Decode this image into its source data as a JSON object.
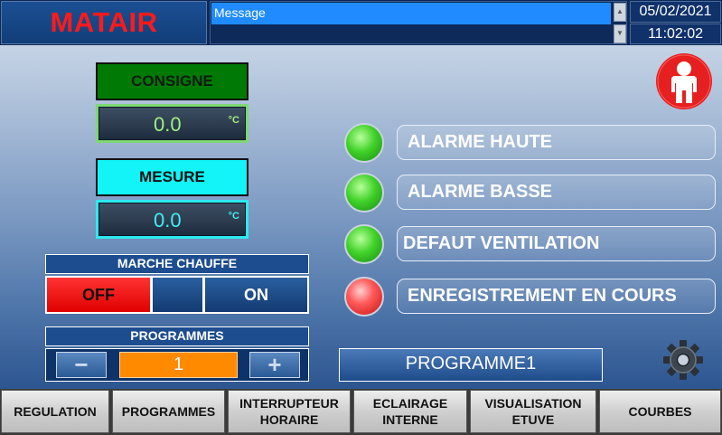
{
  "header": {
    "brand": "MATAIR",
    "message_text": "Message",
    "date": "05/02/2021",
    "time": "11:02:02"
  },
  "consigne": {
    "label": "CONSIGNE",
    "value": "0.0",
    "unit": "°C"
  },
  "mesure": {
    "label": "MESURE",
    "value": "0.0",
    "unit": "°C"
  },
  "marche_chauffe": {
    "title": "MARCHE CHAUFFE",
    "off_label": "OFF",
    "on_label": "ON",
    "state": "OFF"
  },
  "programmes": {
    "title": "PROGRAMMES",
    "minus_label": "−",
    "plus_label": "+",
    "value": "1"
  },
  "alarms": [
    {
      "label": "ALARME HAUTE",
      "status": "green"
    },
    {
      "label": "ALARME BASSE",
      "status": "green"
    },
    {
      "label": "DEFAUT VENTILATION",
      "status": "green"
    },
    {
      "label": "ENREGISTREMENT EN COURS",
      "status": "red"
    }
  ],
  "program_name": "PROGRAMME1",
  "icons": {
    "user": "user-icon",
    "settings": "gear-icon"
  },
  "colors": {
    "brand": "#ff1a1a",
    "consigne_bg": "#017a05",
    "mesure_bg": "#12f4f8",
    "off_active": "#ff1a1a",
    "program_value_bg": "#ff8a00",
    "led_green": "#41d22a",
    "led_red": "#ff3a3a"
  },
  "nav": [
    {
      "line1": "REGULATION",
      "line2": ""
    },
    {
      "line1": "PROGRAMMES",
      "line2": ""
    },
    {
      "line1": "INTERRUPTEUR",
      "line2": "HORAIRE"
    },
    {
      "line1": "ECLAIRAGE",
      "line2": "INTERNE"
    },
    {
      "line1": "VISUALISATION",
      "line2": "ETUVE"
    },
    {
      "line1": "COURBES",
      "line2": ""
    }
  ]
}
